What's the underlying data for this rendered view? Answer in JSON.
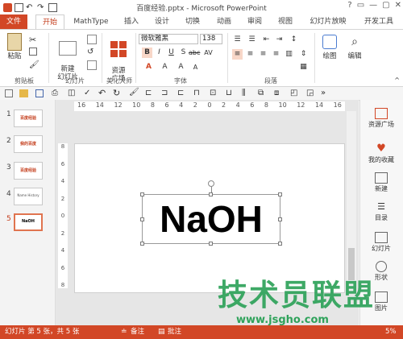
{
  "window": {
    "title": "百度经验.pptx - Microsoft PowerPoint",
    "controls": [
      "?",
      "▭",
      "—",
      "▢",
      "✕"
    ]
  },
  "tabs": [
    {
      "label": "文件"
    },
    {
      "label": "开始"
    },
    {
      "label": "MathType"
    },
    {
      "label": "插入"
    },
    {
      "label": "设计"
    },
    {
      "label": "切换"
    },
    {
      "label": "动画"
    },
    {
      "label": "审阅"
    },
    {
      "label": "视图"
    },
    {
      "label": "幻灯片放映"
    },
    {
      "label": "开发工具"
    }
  ],
  "ribbon": {
    "groups": [
      "剪贴板",
      "幻灯片",
      "美化大师",
      "字体",
      "段落"
    ],
    "paste": "粘贴",
    "new_slide": "新建\n幻灯片",
    "resource": "资源\n广场",
    "drawing": "绘图",
    "editing": "编辑",
    "font_name": "微软雅黑",
    "font_size": "138",
    "format_buttons": [
      "B",
      "I",
      "U",
      "S",
      "abc",
      "AV"
    ]
  },
  "thumbnails": [
    {
      "num": "1",
      "text": "百度经验"
    },
    {
      "num": "2",
      "text": "我的百度"
    },
    {
      "num": "3",
      "text": "百度经验"
    },
    {
      "num": "4",
      "text": "Name History"
    },
    {
      "num": "5",
      "text": "NaOH"
    }
  ],
  "ruler": {
    "h_ticks": [
      "16",
      "14",
      "12",
      "10",
      "8",
      "6",
      "4",
      "2",
      "0",
      "2",
      "4",
      "6",
      "8",
      "10",
      "12",
      "14",
      "16"
    ],
    "v_ticks": [
      "8",
      "6",
      "4",
      "2",
      "0",
      "2",
      "4",
      "6",
      "8"
    ]
  },
  "slide": {
    "text": "NaOH"
  },
  "right_pane": [
    {
      "label": "资源广场",
      "icon": "store-icon"
    },
    {
      "label": "我的收藏",
      "icon": "heart-icon"
    },
    {
      "label": "新建",
      "icon": "new-icon"
    },
    {
      "label": "目录",
      "icon": "list-icon"
    },
    {
      "label": "幻灯片",
      "icon": "slides-icon"
    },
    {
      "label": "形状",
      "icon": "shape-icon"
    },
    {
      "label": "图片",
      "icon": "picture-icon"
    }
  ],
  "status": {
    "slide_info": "幻灯片 第 5 张，共 5 张",
    "notes": "备注",
    "comments": "批注",
    "zoom": "5%"
  },
  "watermark": {
    "text": "技术员联盟",
    "url": "www.jsgho.com"
  },
  "colors": {
    "accent": "#d24726",
    "watermark": "#2ea25a"
  }
}
